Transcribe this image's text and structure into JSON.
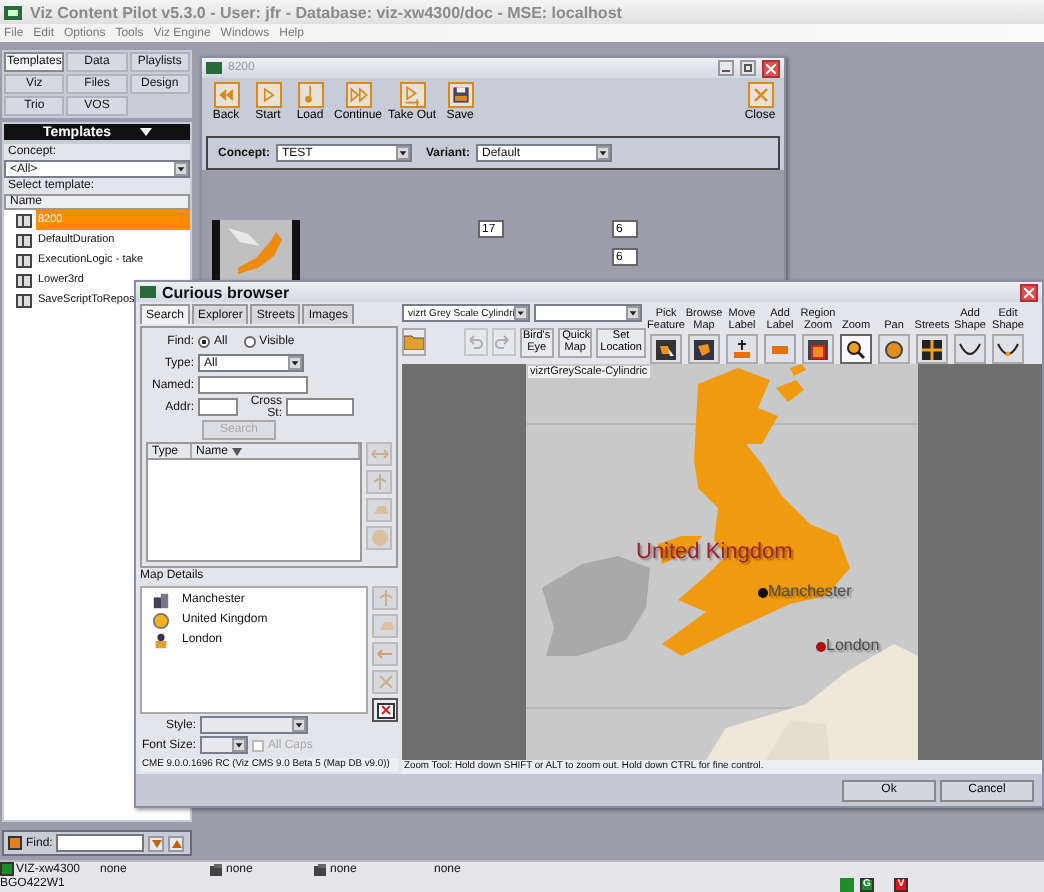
{
  "app": {
    "title": "Viz Content Pilot v5.3.0 - User: jfr - Database: viz-xw4300/doc - MSE: localhost",
    "menu": [
      "File",
      "Edit",
      "Options",
      "Tools",
      "Viz Engine",
      "Windows",
      "Help"
    ]
  },
  "left_panel": {
    "tabs": [
      {
        "label": "Templates",
        "selected": true
      },
      {
        "label": "Data",
        "selected": false
      },
      {
        "label": "Playlists",
        "selected": false
      },
      {
        "label": "Viz",
        "selected": false
      },
      {
        "label": "Files",
        "selected": false
      },
      {
        "label": "Design",
        "selected": false
      },
      {
        "label": "Trio",
        "selected": false
      },
      {
        "label": "VOS",
        "selected": false
      }
    ],
    "header": "Templates",
    "concept_label": "Concept:",
    "concept_value": "<All>",
    "select_label": "Select template:",
    "column": "Name",
    "templates": [
      {
        "name": "8200",
        "selected": true
      },
      {
        "name": "DefaultDuration",
        "selected": false
      },
      {
        "name": "ExecutionLogic - take",
        "selected": false
      },
      {
        "name": "Lower3rd",
        "selected": false
      },
      {
        "name": "SaveScriptToRepos",
        "selected": false
      }
    ],
    "find_label": "Find:"
  },
  "template_window": {
    "title": "8200",
    "tools": [
      {
        "label": "Back",
        "kind": "back"
      },
      {
        "label": "Start",
        "kind": "start"
      },
      {
        "label": "Load",
        "kind": "load"
      },
      {
        "label": "Continue",
        "kind": "continue"
      },
      {
        "label": "Take Out",
        "kind": "takeout"
      },
      {
        "label": "Save",
        "kind": "save"
      }
    ],
    "close_label": "Close",
    "concept_label": "Concept:",
    "concept_value": "TEST",
    "variant_label": "Variant:",
    "variant_value": "Default",
    "fields": [
      "17",
      "6",
      "6"
    ]
  },
  "browser": {
    "title": "Curious browser",
    "tabs": [
      {
        "label": "Search",
        "selected": true
      },
      {
        "label": "Explorer",
        "selected": false
      },
      {
        "label": "Streets",
        "selected": false
      },
      {
        "label": "Images",
        "selected": false
      }
    ],
    "find_label": "Find:",
    "find_options": [
      {
        "label": "All",
        "selected": true
      },
      {
        "label": "Visible",
        "selected": false
      }
    ],
    "type_label": "Type:",
    "type_value": "All",
    "named_label": "Named:",
    "addr_label": "Addr:",
    "cross_label": "Cross St:",
    "search_button": {
      "label": "Search",
      "disabled": true
    },
    "columns": [
      "Type",
      "Name"
    ],
    "details_label": "Map Details",
    "details": [
      {
        "name": "Manchester",
        "kind": "city"
      },
      {
        "name": "United Kingdom",
        "kind": "country"
      },
      {
        "name": "London",
        "kind": "capital"
      }
    ],
    "style_label": "Style:",
    "font_size_label": "Font Size:",
    "all_caps": {
      "label": "All Caps",
      "checked": false,
      "disabled": true
    },
    "version": "CME 9.0.0.1696 RC (Viz CMS 9.0 Beta 5 (Map DB v9.0))",
    "map_style": "vizrt Grey Scale Cylindri",
    "view_buttons": [
      "Bird's Eye",
      "Quick Map",
      "Set Location"
    ],
    "map_tools": [
      {
        "label": "Pick Feature",
        "kind": "feature",
        "selected": false
      },
      {
        "label": "Browse Map",
        "kind": "browse",
        "selected": false
      },
      {
        "label": "Move Label",
        "kind": "move",
        "selected": false
      },
      {
        "label": "Add Label",
        "kind": "label",
        "selected": false
      },
      {
        "label": "Region Zoom",
        "kind": "region",
        "selected": false
      },
      {
        "label": "Zoom",
        "kind": "zoom",
        "selected": true
      },
      {
        "label": "Pan",
        "kind": "pan",
        "selected": false
      },
      {
        "label": "Streets",
        "kind": "streets",
        "selected": false
      },
      {
        "label": "Add Shape",
        "kind": "shape",
        "selected": false
      },
      {
        "label": "Edit Shape",
        "kind": "edit",
        "selected": false
      }
    ],
    "map_name": "vizrtGreyScale-Cylindric",
    "map_labels": [
      {
        "text": "United Kingdom",
        "kind": "country"
      },
      {
        "text": "Manchester",
        "kind": "city"
      },
      {
        "text": "London",
        "kind": "capital"
      }
    ],
    "hint": "Zoom Tool: Hold down SHIFT or ALT to zoom out. Hold down CTRL for fine control.",
    "buttons": [
      "Ok",
      "Cancel"
    ]
  },
  "status_bar": {
    "items": [
      {
        "text": "VIZ-xw4300",
        "kind": "led"
      },
      {
        "text": "none",
        "kind": "plain"
      },
      {
        "text": "none",
        "kind": "icon"
      },
      {
        "text": "none",
        "kind": "icon"
      },
      {
        "text": "none",
        "kind": "plain"
      }
    ],
    "host": "BGO422W1",
    "indicators": [
      {
        "label": "G",
        "color": "#1e8c28"
      },
      {
        "label": "V",
        "color": "#e0141e"
      }
    ]
  }
}
